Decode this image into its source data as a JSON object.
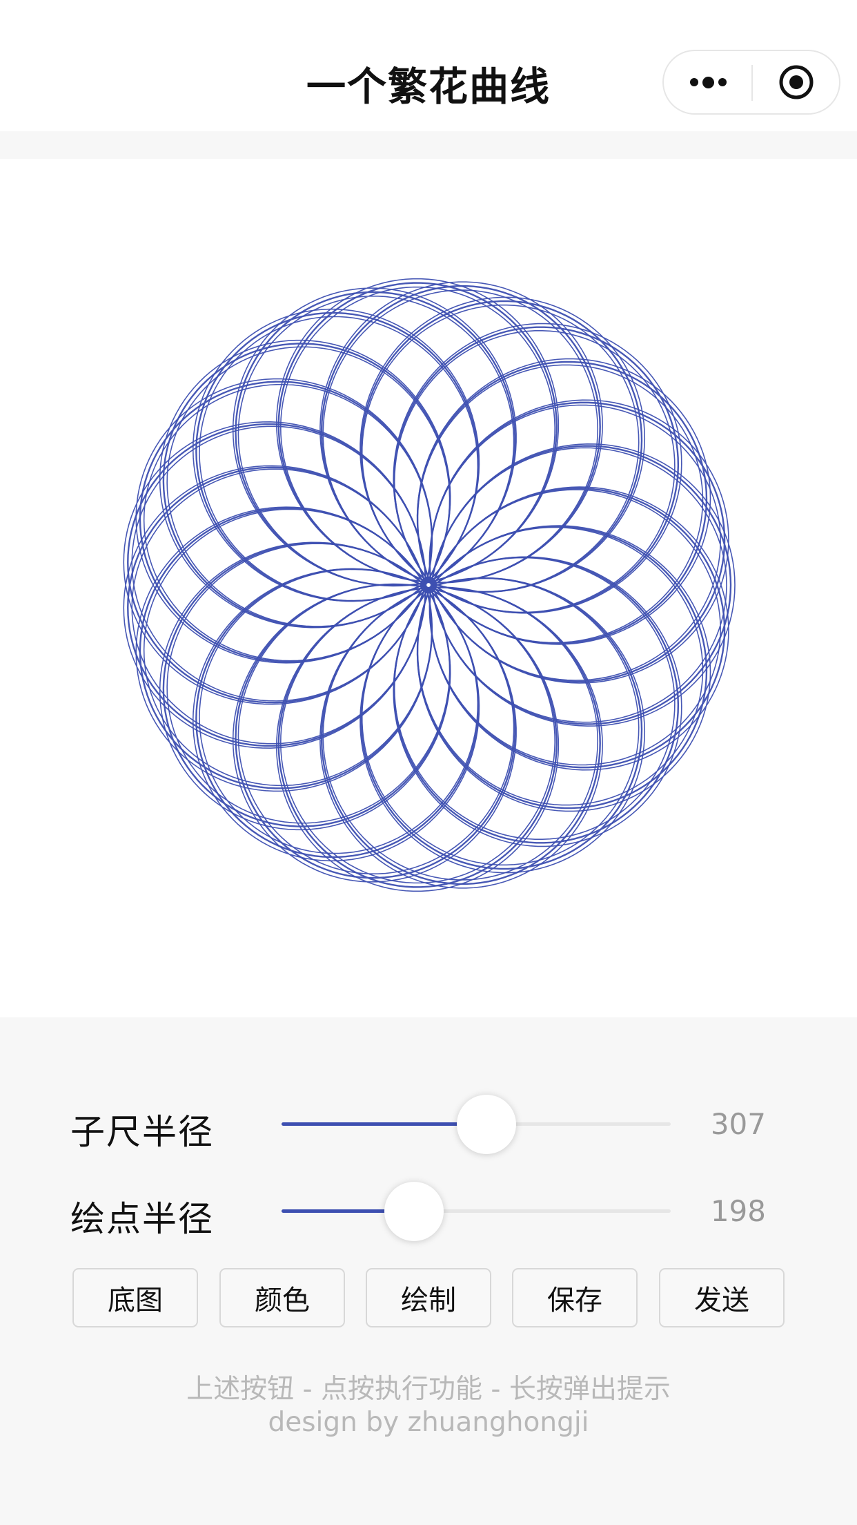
{
  "navbar": {
    "title": "一个繁花曲线",
    "more_icon": "more-dots-icon",
    "close_icon": "target-close-icon"
  },
  "drawing": {
    "stroke_color": "#3d4fb1",
    "background": "#ffffff"
  },
  "sliders": [
    {
      "label": "子尺半径",
      "value": "307",
      "fraction": 0.526
    },
    {
      "label": "绘点半径",
      "value": "198",
      "fraction": 0.34
    }
  ],
  "accent_color": "#3d4fb1",
  "buttons": [
    "底图",
    "颜色",
    "绘制",
    "保存",
    "发送"
  ],
  "hints": {
    "line1": "上述按钮 - 点按执行功能 - 长按弹出提示",
    "line2": "design by zhuanghongji"
  }
}
